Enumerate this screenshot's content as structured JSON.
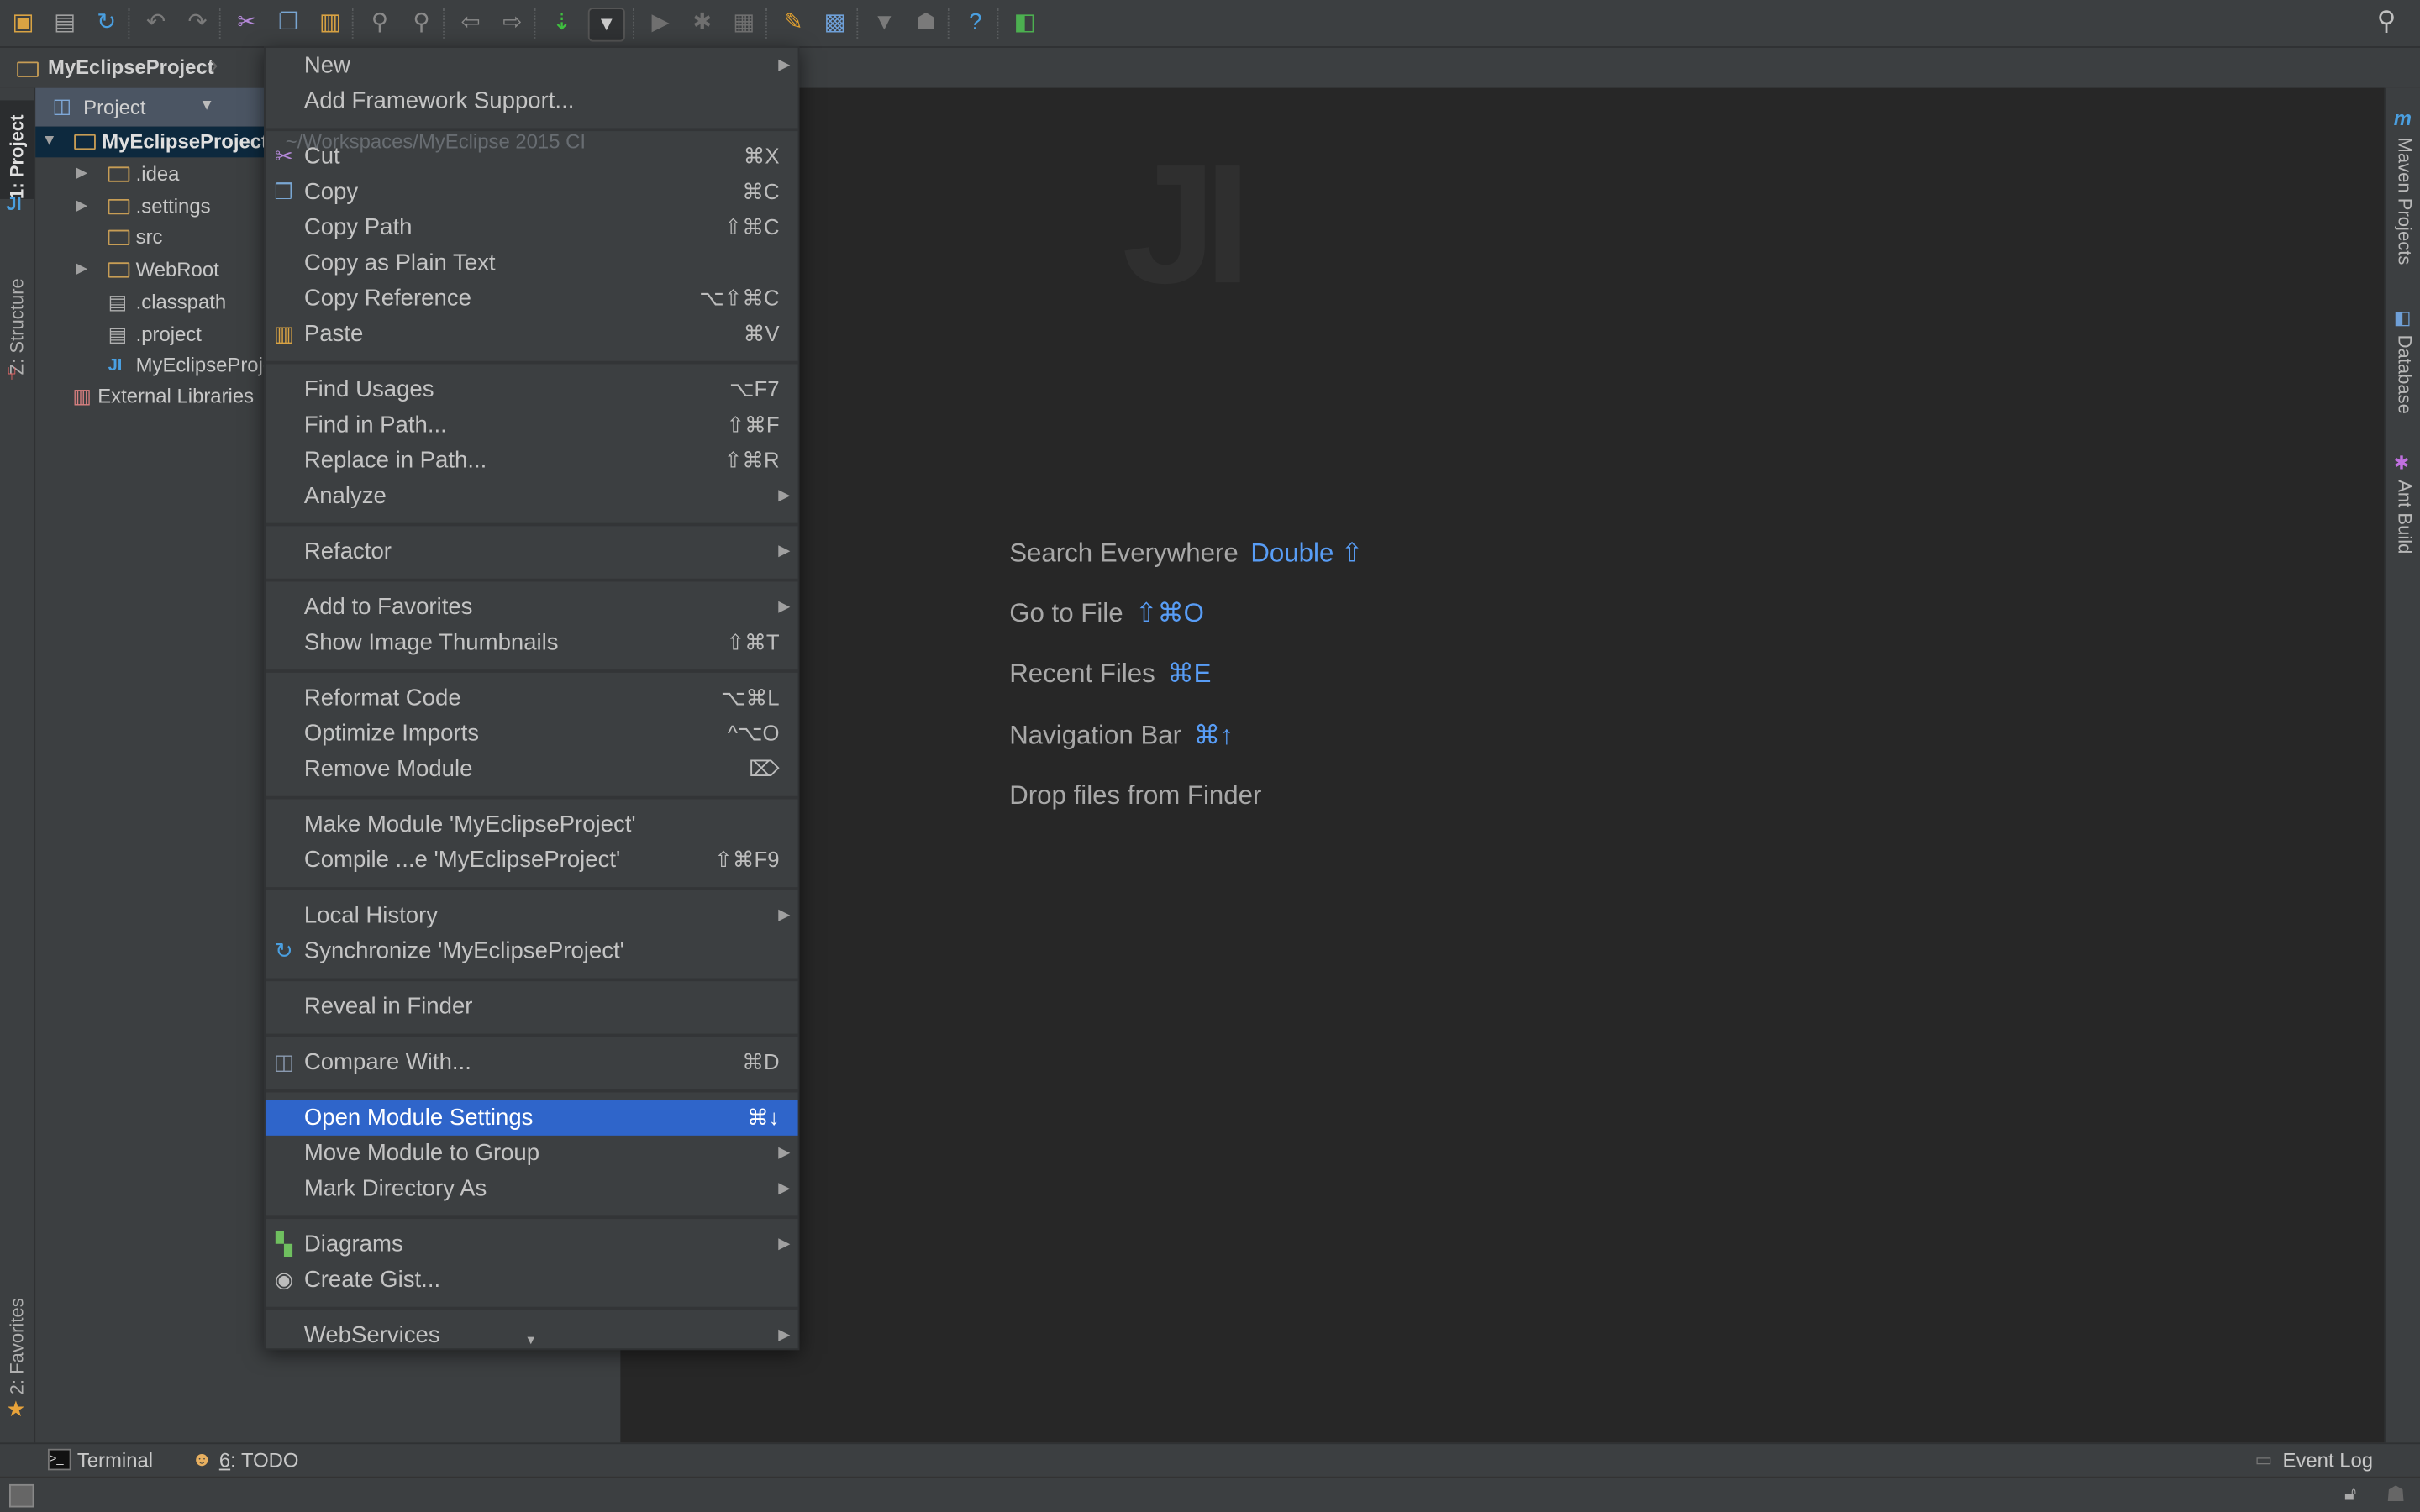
{
  "toolbar": {
    "icons": [
      {
        "name": "open-folder-icon",
        "glyph": "▣",
        "color": "#d9a343"
      },
      {
        "name": "save-icon",
        "glyph": "▤",
        "color": "#a0a0a0"
      },
      {
        "name": "sync-icon",
        "glyph": "↻",
        "color": "#4a9fe0"
      },
      {
        "name": "undo-icon",
        "glyph": "↶",
        "color": "#7a7a7a"
      },
      {
        "name": "redo-icon",
        "glyph": "↷",
        "color": "#7a7a7a"
      },
      {
        "name": "cut-icon",
        "glyph": "✂",
        "color": "#b488d8"
      },
      {
        "name": "copy-icon",
        "glyph": "❐",
        "color": "#79a6d2"
      },
      {
        "name": "paste-icon",
        "glyph": "▥",
        "color": "#d9a343"
      },
      {
        "name": "find-icon",
        "glyph": "⚲",
        "color": "#8a8a8a"
      },
      {
        "name": "replace-icon",
        "glyph": "⚲",
        "color": "#8a8a8a"
      },
      {
        "name": "back-icon",
        "glyph": "⇦",
        "color": "#8a8a8a"
      },
      {
        "name": "forward-icon",
        "glyph": "⇨",
        "color": "#8a8a8a"
      },
      {
        "name": "make-icon",
        "glyph": "⇣",
        "color": "#3fbf3f"
      },
      {
        "name": "run-config-dropdown-icon",
        "glyph": "▾",
        "color": "#c8c8c8"
      },
      {
        "name": "run-icon",
        "glyph": "▶",
        "color": "#6f6f6f"
      },
      {
        "name": "debug-icon",
        "glyph": "✱",
        "color": "#6f6f6f"
      },
      {
        "name": "coverage-icon",
        "glyph": "▦",
        "color": "#6f6f6f"
      },
      {
        "name": "settings-icon",
        "glyph": "✎",
        "color": "#e0a030"
      },
      {
        "name": "project-structure-icon",
        "glyph": "▩",
        "color": "#6fa0d8"
      },
      {
        "name": "sdk-manager-icon",
        "glyph": "▼",
        "color": "#7a7a7a"
      },
      {
        "name": "android-icon",
        "glyph": "☗",
        "color": "#7a7a7a"
      },
      {
        "name": "help-icon",
        "glyph": "?",
        "color": "#4a9fe0"
      },
      {
        "name": "vcs-icon",
        "glyph": "◧",
        "color": "#4caf50"
      }
    ],
    "search_icon": "search-icon"
  },
  "navbar": {
    "breadcrumb": "MyEclipseProject"
  },
  "left_tabs": {
    "project": "1: Project",
    "structure": "Z: Structure",
    "favorites": "2: Favorites"
  },
  "right_tabs": {
    "maven": "Maven Projects",
    "database": "Database",
    "ant": "Ant Build"
  },
  "project_panel": {
    "view_selector": "Project",
    "root": "MyEclipseProject",
    "root_path": "~/Workspaces/MyEclipse 2015 CI",
    "tree": [
      {
        "label": ".idea",
        "type": "folder",
        "expandable": true
      },
      {
        "label": ".settings",
        "type": "folder",
        "expandable": true
      },
      {
        "label": "src",
        "type": "folder",
        "expandable": false
      },
      {
        "label": "WebRoot",
        "type": "folder",
        "expandable": true
      },
      {
        "label": ".classpath",
        "type": "file",
        "expandable": false
      },
      {
        "label": ".project",
        "type": "file",
        "expandable": false
      },
      {
        "label": "MyEclipseProject.iml",
        "type": "module",
        "expandable": false
      }
    ],
    "external": "External Libraries"
  },
  "context_menu": {
    "items": [
      {
        "label": "New",
        "submenu": true
      },
      {
        "label": "Add Framework Support..."
      },
      {
        "sep": true
      },
      {
        "label": "Cut",
        "shortcut": "⌘X",
        "icon": "cut-icon"
      },
      {
        "label": "Copy",
        "shortcut": "⌘C",
        "icon": "copy-icon"
      },
      {
        "label": "Copy Path",
        "shortcut": "⇧⌘C"
      },
      {
        "label": "Copy as Plain Text"
      },
      {
        "label": "Copy Reference",
        "shortcut": "⌥⇧⌘C"
      },
      {
        "label": "Paste",
        "shortcut": "⌘V",
        "icon": "paste-icon"
      },
      {
        "sep": true
      },
      {
        "label": "Find Usages",
        "shortcut": "⌥F7"
      },
      {
        "label": "Find in Path...",
        "shortcut": "⇧⌘F"
      },
      {
        "label": "Replace in Path...",
        "shortcut": "⇧⌘R"
      },
      {
        "label": "Analyze",
        "submenu": true
      },
      {
        "sep": true
      },
      {
        "label": "Refactor",
        "submenu": true
      },
      {
        "sep": true
      },
      {
        "label": "Add to Favorites",
        "submenu": true
      },
      {
        "label": "Show Image Thumbnails",
        "shortcut": "⇧⌘T"
      },
      {
        "sep": true
      },
      {
        "label": "Reformat Code",
        "shortcut": "⌥⌘L"
      },
      {
        "label": "Optimize Imports",
        "shortcut": "^⌥O"
      },
      {
        "label": "Remove Module",
        "shortcut": "⌦"
      },
      {
        "sep": true
      },
      {
        "label": "Make Module 'MyEclipseProject'"
      },
      {
        "label": "Compile ...e 'MyEclipseProject'",
        "shortcut": "⇧⌘F9"
      },
      {
        "sep": true
      },
      {
        "label": "Local History",
        "submenu": true
      },
      {
        "label": "Synchronize 'MyEclipseProject'",
        "icon": "sync-icon"
      },
      {
        "sep": true
      },
      {
        "label": "Reveal in Finder"
      },
      {
        "sep": true
      },
      {
        "label": "Compare With...",
        "shortcut": "⌘D",
        "icon": "compare-icon"
      },
      {
        "sep": true
      },
      {
        "label": "Open Module Settings",
        "shortcut": "⌘↓",
        "selected": true
      },
      {
        "label": "Move Module to Group",
        "submenu": true
      },
      {
        "label": "Mark Directory As",
        "submenu": true
      },
      {
        "sep": true
      },
      {
        "label": "Diagrams",
        "submenu": true,
        "icon": "diagrams-icon"
      },
      {
        "label": "Create Gist...",
        "icon": "github-icon"
      },
      {
        "sep": true
      },
      {
        "label": "WebServices",
        "submenu": true
      }
    ],
    "icon_glyphs": {
      "cut-icon": "✂",
      "copy-icon": "❐",
      "paste-icon": "▥",
      "sync-icon": "↻",
      "compare-icon": "◫",
      "diagrams-icon": "▚",
      "github-icon": "◉"
    },
    "icon_colors": {
      "cut-icon": "#b488d8",
      "copy-icon": "#79a6d2",
      "paste-icon": "#d9a343",
      "sync-icon": "#4a9fe0",
      "compare-icon": "#8a9ab0",
      "diagrams-icon": "#6fbf5f",
      "github-icon": "#bbbbbb"
    },
    "selected_color": "#2f65ca"
  },
  "welcome": [
    {
      "text": "Search Everywhere",
      "shortcut": "Double ⇧"
    },
    {
      "text": "Go to File",
      "shortcut": "⇧⌘O"
    },
    {
      "text": "Recent Files",
      "shortcut": "⌘E"
    },
    {
      "text": "Navigation Bar",
      "shortcut": "⌘↑"
    },
    {
      "text": "Drop files from Finder",
      "shortcut": ""
    }
  ],
  "bottom_tabs": {
    "terminal": "Terminal",
    "todo_num": "6",
    "todo": ": TODO",
    "event_log": "Event Log"
  },
  "accent_color": "#589df6"
}
